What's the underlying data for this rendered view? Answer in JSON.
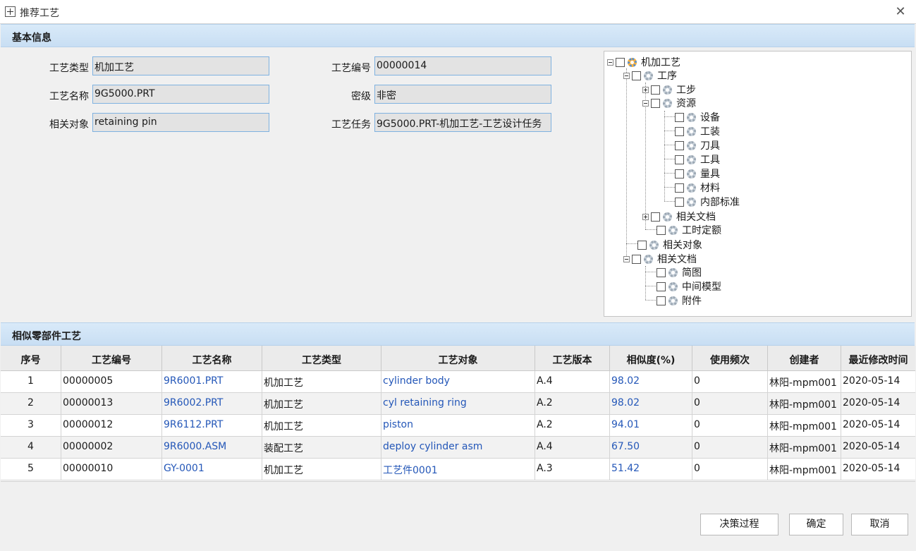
{
  "window": {
    "title": "推荐工艺",
    "close_glyph": "✕"
  },
  "basic_info": {
    "header": "基本信息",
    "fields": {
      "type_label": "工艺类型",
      "type_value": "机加工艺",
      "name_label": "工艺名称",
      "name_value": "9G5000.PRT",
      "object_label": "相关对象",
      "object_value": "retaining pin",
      "code_label": "工艺编号",
      "code_value": "00000014",
      "secret_label": "密级",
      "secret_value": "非密",
      "task_label": "工艺任务",
      "task_value": "9G5000.PRT-机加工艺-工艺设计任务"
    }
  },
  "tree": {
    "root": "机加工艺",
    "gongxu": "工序",
    "gongbu": "工步",
    "ziyuan": "资源",
    "shebei": "设备",
    "gongzhuang": "工装",
    "daoju": "刀具",
    "gongju": "工具",
    "liangju": "量具",
    "cailiao": "材料",
    "neibu": "内部标准",
    "xgwd1": "相关文档",
    "gsde": "工时定额",
    "xgdx": "相关对象",
    "xgwd2": "相关文档",
    "jiantu": "简图",
    "zjmx": "中间模型",
    "fujian": "附件"
  },
  "similar": {
    "header": "相似零部件工艺",
    "columns": [
      "序号",
      "工艺编号",
      "工艺名称",
      "工艺类型",
      "工艺对象",
      "工艺版本",
      "相似度(%)",
      "使用频次",
      "创建者",
      "最近修改时间"
    ],
    "rows": [
      [
        "1",
        "00000005",
        "9R6001.PRT",
        "机加工艺",
        "cylinder body",
        "A.4",
        "98.02",
        "0",
        "林阳-mpm001",
        "2020-05-14"
      ],
      [
        "2",
        "00000013",
        "9R6002.PRT",
        "机加工艺",
        "cyl retaining ring",
        "A.2",
        "98.02",
        "0",
        "林阳-mpm001",
        "2020-05-14"
      ],
      [
        "3",
        "00000012",
        "9R6112.PRT",
        "机加工艺",
        "piston",
        "A.2",
        "94.01",
        "0",
        "林阳-mpm001",
        "2020-05-14"
      ],
      [
        "4",
        "00000002",
        "9R6000.ASM",
        "装配工艺",
        "deploy cylinder asm",
        "A.4",
        "67.50",
        "0",
        "林阳-mpm001",
        "2020-05-14"
      ],
      [
        "5",
        "00000010",
        "GY-0001",
        "机加工艺",
        "工艺件0001",
        "A.3",
        "51.42",
        "0",
        "林阳-mpm001",
        "2020-05-14"
      ]
    ]
  },
  "buttons": {
    "decision": "决策过程",
    "ok": "确定",
    "cancel": "取消"
  }
}
